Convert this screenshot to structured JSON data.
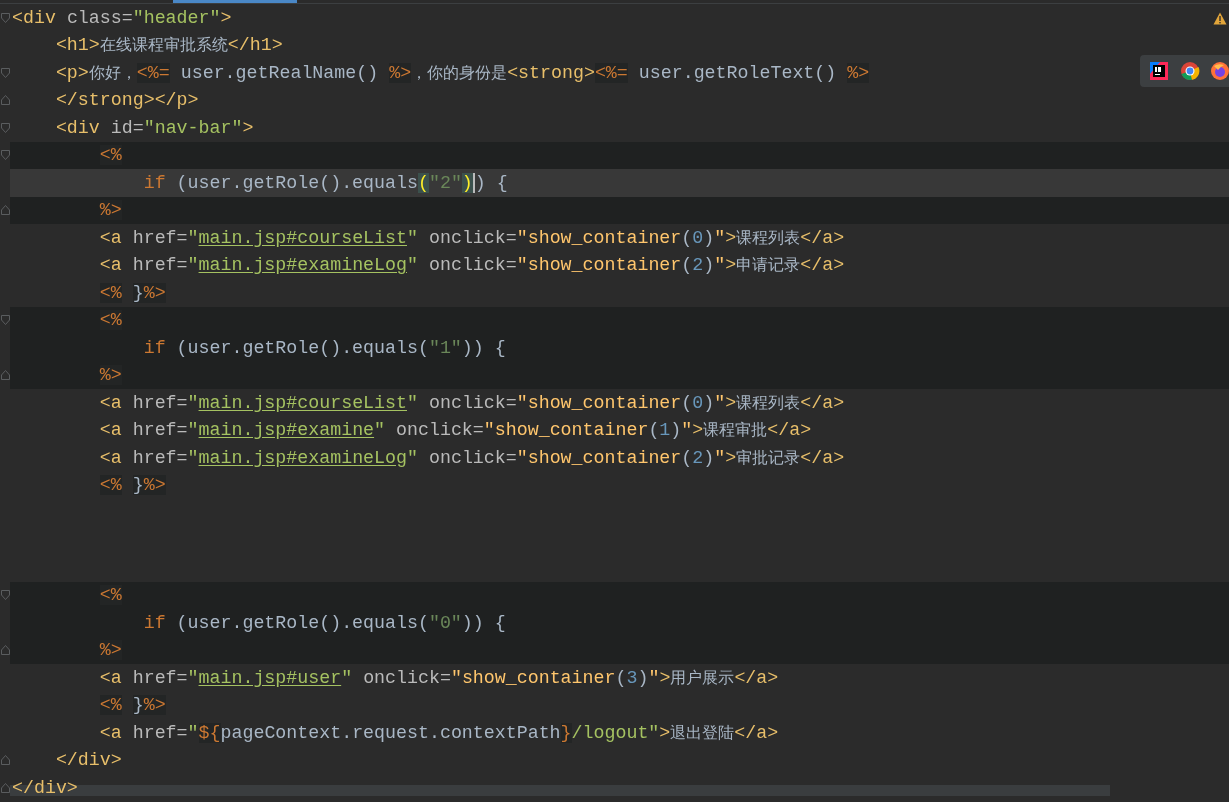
{
  "lines": [
    {
      "kind": "code",
      "fold_start": true,
      "tokens": [
        {
          "text": "<div",
          "kind": "tag"
        },
        {
          "text": " class=",
          "kind": "attr"
        },
        {
          "text": "\"header\"",
          "kind": "value"
        },
        {
          "text": ">",
          "kind": "tag"
        }
      ]
    },
    {
      "kind": "code",
      "tokens": [
        {
          "text": "    <h1>",
          "kind": "tag"
        },
        {
          "text": "在线课程审批系统",
          "kind": "text"
        },
        {
          "text": "</h1>",
          "kind": "tag"
        }
      ]
    },
    {
      "kind": "code",
      "fold_start": true,
      "tokens": [
        {
          "text": "    <p>",
          "kind": "tag"
        },
        {
          "text": "你好，",
          "kind": "text"
        },
        {
          "text": "<%=",
          "kind": "jsp"
        },
        {
          "text": " user.getRealName() ",
          "kind": "code"
        },
        {
          "text": "%>",
          "kind": "jsp"
        },
        {
          "text": "，你的身份是",
          "kind": "text"
        },
        {
          "text": "<strong>",
          "kind": "tag"
        },
        {
          "text": "<%=",
          "kind": "jsp"
        },
        {
          "text": " user.getRoleText() ",
          "kind": "code"
        },
        {
          "text": "%>",
          "kind": "jsp"
        }
      ]
    },
    {
      "kind": "code",
      "fold_end": true,
      "tokens": [
        {
          "text": "    </strong></p>",
          "kind": "tag"
        }
      ]
    },
    {
      "kind": "code",
      "fold_start": true,
      "tokens": [
        {
          "text": "    <div",
          "kind": "tag"
        },
        {
          "text": " id=",
          "kind": "attr"
        },
        {
          "text": "\"nav-bar\"",
          "kind": "value"
        },
        {
          "text": ">",
          "kind": "tag"
        }
      ]
    },
    {
      "kind": "code",
      "fold_start": true,
      "shaded": true,
      "tokens": [
        {
          "text": "        <%",
          "kind": "jsp"
        }
      ]
    },
    {
      "kind": "code",
      "current": true,
      "tokens": [
        {
          "text": "            if",
          "kind": "keyword"
        },
        {
          "text": " (user.getRole().equals",
          "kind": "code"
        },
        {
          "text": "(",
          "kind": "match"
        },
        {
          "text": "\"2\"",
          "kind": "string"
        },
        {
          "text": ")",
          "kind": "match",
          "caret": true
        },
        {
          "text": ") {",
          "kind": "code"
        }
      ]
    },
    {
      "kind": "code",
      "fold_end": true,
      "shaded": true,
      "tokens": [
        {
          "text": "        %>",
          "kind": "jsp"
        }
      ]
    },
    {
      "kind": "code",
      "tokens": [
        {
          "text": "        <a",
          "kind": "tag"
        },
        {
          "text": " href=",
          "kind": "attr"
        },
        {
          "text": "\"",
          "kind": "value"
        },
        {
          "text": "main.jsp#courseList",
          "kind": "link"
        },
        {
          "text": "\"",
          "kind": "value"
        },
        {
          "text": " onclick=",
          "kind": "attr"
        },
        {
          "text": "\"show_container",
          "kind": "func"
        },
        {
          "text": "(",
          "kind": "code"
        },
        {
          "text": "0",
          "kind": "number"
        },
        {
          "text": ")",
          "kind": "code"
        },
        {
          "text": "\"",
          "kind": "func"
        },
        {
          "text": ">",
          "kind": "tag"
        },
        {
          "text": "课程列表",
          "kind": "text"
        },
        {
          "text": "</a>",
          "kind": "tag"
        }
      ]
    },
    {
      "kind": "code",
      "tokens": [
        {
          "text": "        <a",
          "kind": "tag"
        },
        {
          "text": " href=",
          "kind": "attr"
        },
        {
          "text": "\"",
          "kind": "value"
        },
        {
          "text": "main.jsp#examineLog",
          "kind": "link"
        },
        {
          "text": "\"",
          "kind": "value"
        },
        {
          "text": " onclick=",
          "kind": "attr"
        },
        {
          "text": "\"show_container",
          "kind": "func"
        },
        {
          "text": "(",
          "kind": "code"
        },
        {
          "text": "2",
          "kind": "number"
        },
        {
          "text": ")",
          "kind": "code"
        },
        {
          "text": "\"",
          "kind": "func"
        },
        {
          "text": ">",
          "kind": "tag"
        },
        {
          "text": "申请记录",
          "kind": "text"
        },
        {
          "text": "</a>",
          "kind": "tag"
        }
      ]
    },
    {
      "kind": "code",
      "tokens": [
        {
          "text": "        <%",
          "kind": "jsp"
        },
        {
          "text": " }",
          "kind": "jspcode"
        },
        {
          "text": "%>",
          "kind": "jsp"
        }
      ]
    },
    {
      "kind": "code",
      "fold_start": true,
      "shaded": true,
      "tokens": [
        {
          "text": "        <%",
          "kind": "jsp"
        }
      ]
    },
    {
      "kind": "code",
      "shaded": true,
      "tokens": [
        {
          "text": "            if",
          "kind": "keyword"
        },
        {
          "text": " (user.getRole().equals(",
          "kind": "code"
        },
        {
          "text": "\"1\"",
          "kind": "string"
        },
        {
          "text": ")) {",
          "kind": "code"
        }
      ]
    },
    {
      "kind": "code",
      "fold_end": true,
      "shaded": true,
      "tokens": [
        {
          "text": "        %>",
          "kind": "jsp"
        }
      ]
    },
    {
      "kind": "code",
      "tokens": [
        {
          "text": "        <a",
          "kind": "tag"
        },
        {
          "text": " href=",
          "kind": "attr"
        },
        {
          "text": "\"",
          "kind": "value"
        },
        {
          "text": "main.jsp#courseList",
          "kind": "link"
        },
        {
          "text": "\"",
          "kind": "value"
        },
        {
          "text": " onclick=",
          "kind": "attr"
        },
        {
          "text": "\"show_container",
          "kind": "func"
        },
        {
          "text": "(",
          "kind": "code"
        },
        {
          "text": "0",
          "kind": "number"
        },
        {
          "text": ")",
          "kind": "code"
        },
        {
          "text": "\"",
          "kind": "func"
        },
        {
          "text": ">",
          "kind": "tag"
        },
        {
          "text": "课程列表",
          "kind": "text"
        },
        {
          "text": "</a>",
          "kind": "tag"
        }
      ]
    },
    {
      "kind": "code",
      "tokens": [
        {
          "text": "        <a",
          "kind": "tag"
        },
        {
          "text": " href=",
          "kind": "attr"
        },
        {
          "text": "\"",
          "kind": "value"
        },
        {
          "text": "main.jsp#examine",
          "kind": "link"
        },
        {
          "text": "\"",
          "kind": "value"
        },
        {
          "text": " onclick=",
          "kind": "attr"
        },
        {
          "text": "\"show_container",
          "kind": "func"
        },
        {
          "text": "(",
          "kind": "code"
        },
        {
          "text": "1",
          "kind": "number"
        },
        {
          "text": ")",
          "kind": "code"
        },
        {
          "text": "\"",
          "kind": "func"
        },
        {
          "text": ">",
          "kind": "tag"
        },
        {
          "text": "课程审批",
          "kind": "text"
        },
        {
          "text": "</a>",
          "kind": "tag"
        }
      ]
    },
    {
      "kind": "code",
      "tokens": [
        {
          "text": "        <a",
          "kind": "tag"
        },
        {
          "text": " href=",
          "kind": "attr"
        },
        {
          "text": "\"",
          "kind": "value"
        },
        {
          "text": "main.jsp#examineLog",
          "kind": "link"
        },
        {
          "text": "\"",
          "kind": "value"
        },
        {
          "text": " onclick=",
          "kind": "attr"
        },
        {
          "text": "\"show_container",
          "kind": "func"
        },
        {
          "text": "(",
          "kind": "code"
        },
        {
          "text": "2",
          "kind": "number"
        },
        {
          "text": ")",
          "kind": "code"
        },
        {
          "text": "\"",
          "kind": "func"
        },
        {
          "text": ">",
          "kind": "tag"
        },
        {
          "text": "审批记录",
          "kind": "text"
        },
        {
          "text": "</a>",
          "kind": "tag"
        }
      ]
    },
    {
      "kind": "code",
      "tokens": [
        {
          "text": "        <%",
          "kind": "jsp"
        },
        {
          "text": " }",
          "kind": "jspcode"
        },
        {
          "text": "%>",
          "kind": "jsp"
        }
      ]
    },
    {
      "kind": "blank"
    },
    {
      "kind": "blank"
    },
    {
      "kind": "blank"
    },
    {
      "kind": "code",
      "fold_start": true,
      "shaded": true,
      "tokens": [
        {
          "text": "        <%",
          "kind": "jsp"
        }
      ]
    },
    {
      "kind": "code",
      "shaded": true,
      "tokens": [
        {
          "text": "            if",
          "kind": "keyword"
        },
        {
          "text": " (user.getRole().equals(",
          "kind": "code"
        },
        {
          "text": "\"0\"",
          "kind": "string"
        },
        {
          "text": ")) {",
          "kind": "code"
        }
      ]
    },
    {
      "kind": "code",
      "fold_end": true,
      "shaded": true,
      "tokens": [
        {
          "text": "        %>",
          "kind": "jsp"
        }
      ]
    },
    {
      "kind": "code",
      "tokens": [
        {
          "text": "        <a",
          "kind": "tag"
        },
        {
          "text": " href=",
          "kind": "attr"
        },
        {
          "text": "\"",
          "kind": "value"
        },
        {
          "text": "main.jsp#user",
          "kind": "link"
        },
        {
          "text": "\"",
          "kind": "value"
        },
        {
          "text": " onclick=",
          "kind": "attr"
        },
        {
          "text": "\"show_container",
          "kind": "func"
        },
        {
          "text": "(",
          "kind": "code"
        },
        {
          "text": "3",
          "kind": "number"
        },
        {
          "text": ")",
          "kind": "code"
        },
        {
          "text": "\"",
          "kind": "func"
        },
        {
          "text": ">",
          "kind": "tag"
        },
        {
          "text": "用户展示",
          "kind": "text"
        },
        {
          "text": "</a>",
          "kind": "tag"
        }
      ]
    },
    {
      "kind": "code",
      "tokens": [
        {
          "text": "        <%",
          "kind": "jsp"
        },
        {
          "text": " }",
          "kind": "jspcode"
        },
        {
          "text": "%>",
          "kind": "jsp"
        }
      ]
    },
    {
      "kind": "code",
      "tokens": [
        {
          "text": "        <a",
          "kind": "tag"
        },
        {
          "text": " href=",
          "kind": "attr"
        },
        {
          "text": "\"",
          "kind": "value"
        },
        {
          "text": "${",
          "kind": "el"
        },
        {
          "text": "pageContext.request.contextPath",
          "kind": "code"
        },
        {
          "text": "}",
          "kind": "el"
        },
        {
          "text": "/logout\"",
          "kind": "value"
        },
        {
          "text": ">",
          "kind": "tag"
        },
        {
          "text": "退出登陆",
          "kind": "text"
        },
        {
          "text": "</a>",
          "kind": "tag"
        }
      ]
    },
    {
      "kind": "code",
      "fold_end": true,
      "tokens": [
        {
          "text": "    </div>",
          "kind": "tag"
        }
      ]
    },
    {
      "kind": "code",
      "fold_end": true,
      "tokens": [
        {
          "text": "</div>",
          "kind": "tag"
        }
      ]
    }
  ]
}
